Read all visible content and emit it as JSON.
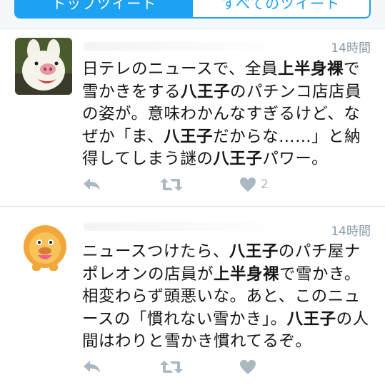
{
  "tabs": [
    {
      "label": "トップツイート",
      "active": true
    },
    {
      "label": "すべてのツイート",
      "active": false
    }
  ],
  "tweets": [
    {
      "time": "14時間",
      "segments": [
        {
          "t": "日テレのニュースで、全員",
          "b": false
        },
        {
          "t": "上半身裸",
          "b": true
        },
        {
          "t": "で雪かきをする",
          "b": false
        },
        {
          "t": "八王子",
          "b": true
        },
        {
          "t": "のパチンコ店店員の姿が。意味わかんなすぎるけど、なぜか「ま、",
          "b": false
        },
        {
          "t": "八王子",
          "b": true
        },
        {
          "t": "だからな……」と納得してしまう謎の",
          "b": false
        },
        {
          "t": "八王子",
          "b": true
        },
        {
          "t": "パワー。",
          "b": false
        }
      ],
      "likes": "2",
      "avatar_icon": "pig-mascot-avatar"
    },
    {
      "time": "14時間",
      "segments": [
        {
          "t": "ニュースつけたら、",
          "b": false
        },
        {
          "t": "八王子",
          "b": true
        },
        {
          "t": "のパチ屋ナポレオンの店員が",
          "b": false
        },
        {
          "t": "上半身裸",
          "b": true
        },
        {
          "t": "で雪かき。相変わらず頭悪いな。あと、このニュースの「慣れない雪かき」。",
          "b": false
        },
        {
          "t": "八王子",
          "b": true
        },
        {
          "t": "の人間はわりと雪かき慣れてるぞ。",
          "b": false
        }
      ],
      "likes": "",
      "avatar_icon": "lion-mascot-avatar"
    }
  ],
  "icons": {
    "reply": "reply-icon",
    "retweet": "retweet-icon",
    "like": "heart-icon"
  },
  "colors": {
    "accent": "#1da1f2",
    "muted": "#8899a6",
    "action": "#aab8c2",
    "text": "#14171a"
  }
}
